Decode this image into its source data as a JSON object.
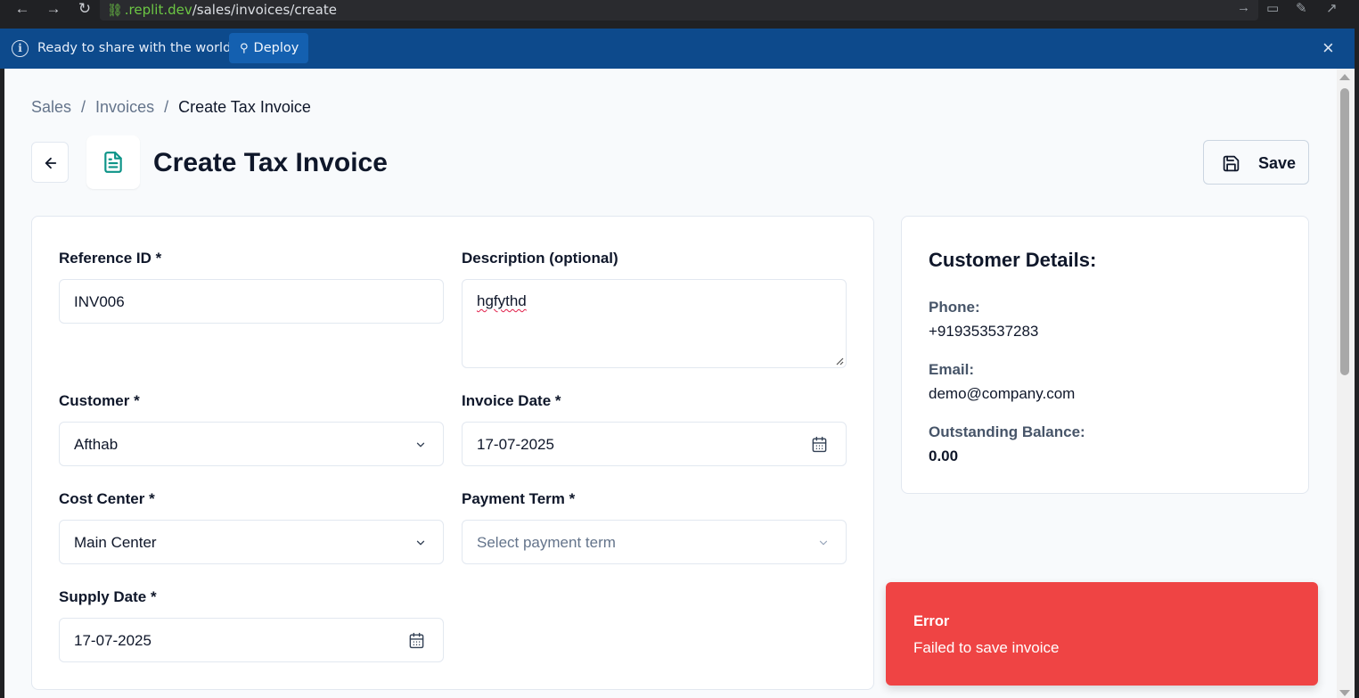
{
  "browser": {
    "url_prefix": "",
    "url_domain": ".replit.dev",
    "url_path": "/sales/invoices/create"
  },
  "banner": {
    "message": "Ready to share with the world?",
    "deploy_label": "Deploy"
  },
  "breadcrumb": {
    "items": [
      "Sales",
      "Invoices",
      "Create Tax Invoice"
    ],
    "separator": "/"
  },
  "header": {
    "title": "Create Tax Invoice",
    "save_label": "Save"
  },
  "form": {
    "reference_id": {
      "label": "Reference ID *",
      "value": "INV006"
    },
    "description": {
      "label": "Description (optional)",
      "value": "hgfythd"
    },
    "customer": {
      "label": "Customer *",
      "value": "Afthab"
    },
    "invoice_date": {
      "label": "Invoice Date *",
      "value": "17-07-2025"
    },
    "cost_center": {
      "label": "Cost Center *",
      "value": "Main Center"
    },
    "payment_term": {
      "label": "Payment Term *",
      "placeholder": "Select payment term"
    },
    "supply_date": {
      "label": "Supply Date *",
      "value": "17-07-2025"
    }
  },
  "customer_details": {
    "title": "Customer Details:",
    "phone_label": "Phone:",
    "phone": "+919353537283",
    "email_label": "Email:",
    "email": "demo@company.com",
    "balance_label": "Outstanding Balance:",
    "balance": "0.00"
  },
  "toast": {
    "title": "Error",
    "message": "Failed to save invoice",
    "color": "#ef4444"
  },
  "colors": {
    "accent_teal": "#0d9488",
    "banner_blue": "#0d4a8c",
    "deploy_blue": "#1460b0"
  }
}
